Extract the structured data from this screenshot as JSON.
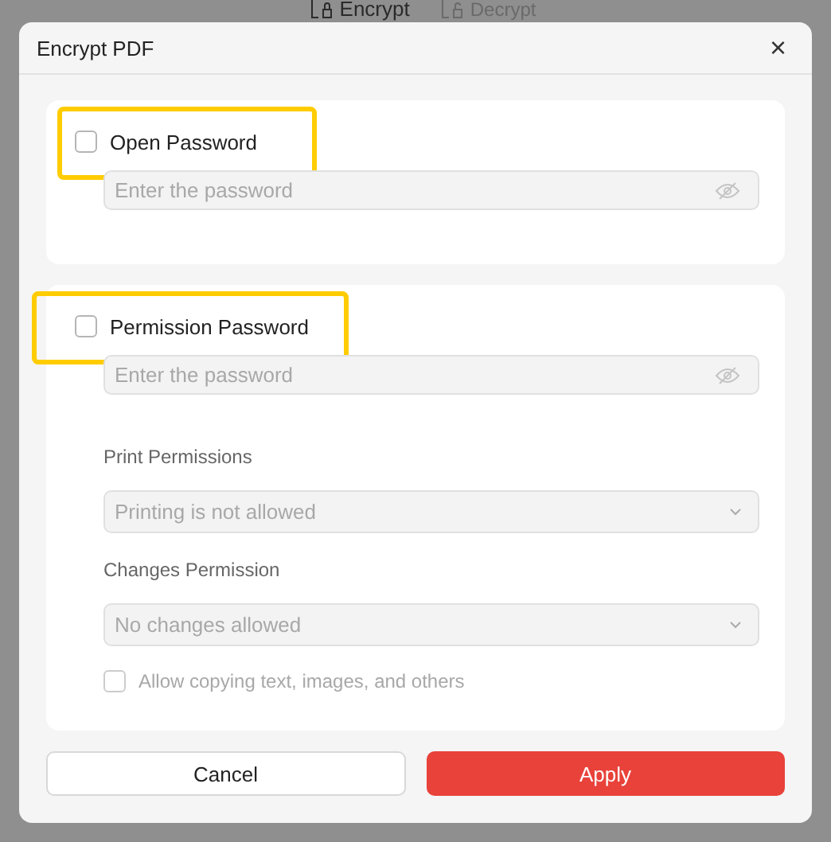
{
  "background_tabs": [
    {
      "label": "Encrypt",
      "selected": true
    },
    {
      "label": "Decrypt",
      "selected": false
    }
  ],
  "dialog": {
    "title": "Encrypt PDF",
    "close": "×"
  },
  "sections": [
    {
      "checkbox": {
        "label": "Open Password",
        "checked": false,
        "highlighted": true
      },
      "password": {
        "placeholder": "Enter the password",
        "disabled": true
      }
    },
    {
      "checkbox": {
        "label": "Permission Password",
        "checked": false,
        "highlighted": true
      },
      "password": {
        "placeholder": "Enter the password",
        "disabled": true
      },
      "fields": [
        {
          "kind": "select",
          "label": "Print Permissions",
          "value": "Printing is not allowed",
          "disabled": true
        },
        {
          "kind": "select",
          "label": "Changes Permission",
          "value": "No changes allowed",
          "disabled": true
        },
        {
          "kind": "checkbox",
          "label": "Allow copying text, images, and others",
          "checked": false,
          "disabled": true
        }
      ]
    }
  ],
  "buttons": [
    {
      "label": "Cancel",
      "kind": "secondary"
    },
    {
      "label": "Apply",
      "kind": "primary"
    }
  ]
}
